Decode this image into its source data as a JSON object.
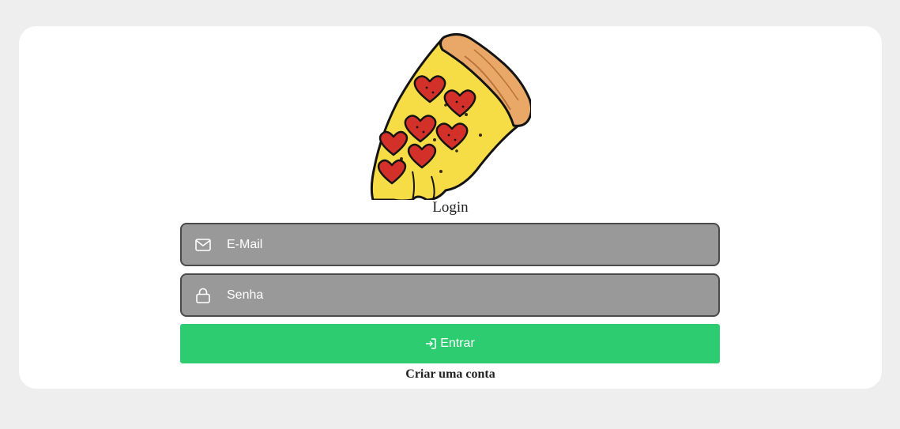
{
  "login": {
    "title": "Login",
    "email_placeholder": "E-Mail",
    "password_placeholder": "Senha",
    "submit_label": "Entrar",
    "create_account_label": "Criar uma conta"
  },
  "icons": {
    "email": "envelope-icon",
    "password": "lock-icon",
    "submit": "log-in-icon",
    "logo": "pizza-slice-icon"
  },
  "colors": {
    "background": "#eeeeee",
    "card": "#ffffff",
    "field_fill": "#999999",
    "field_border": "#4a4a4a",
    "button": "#2ecc71",
    "text": "#222222"
  }
}
